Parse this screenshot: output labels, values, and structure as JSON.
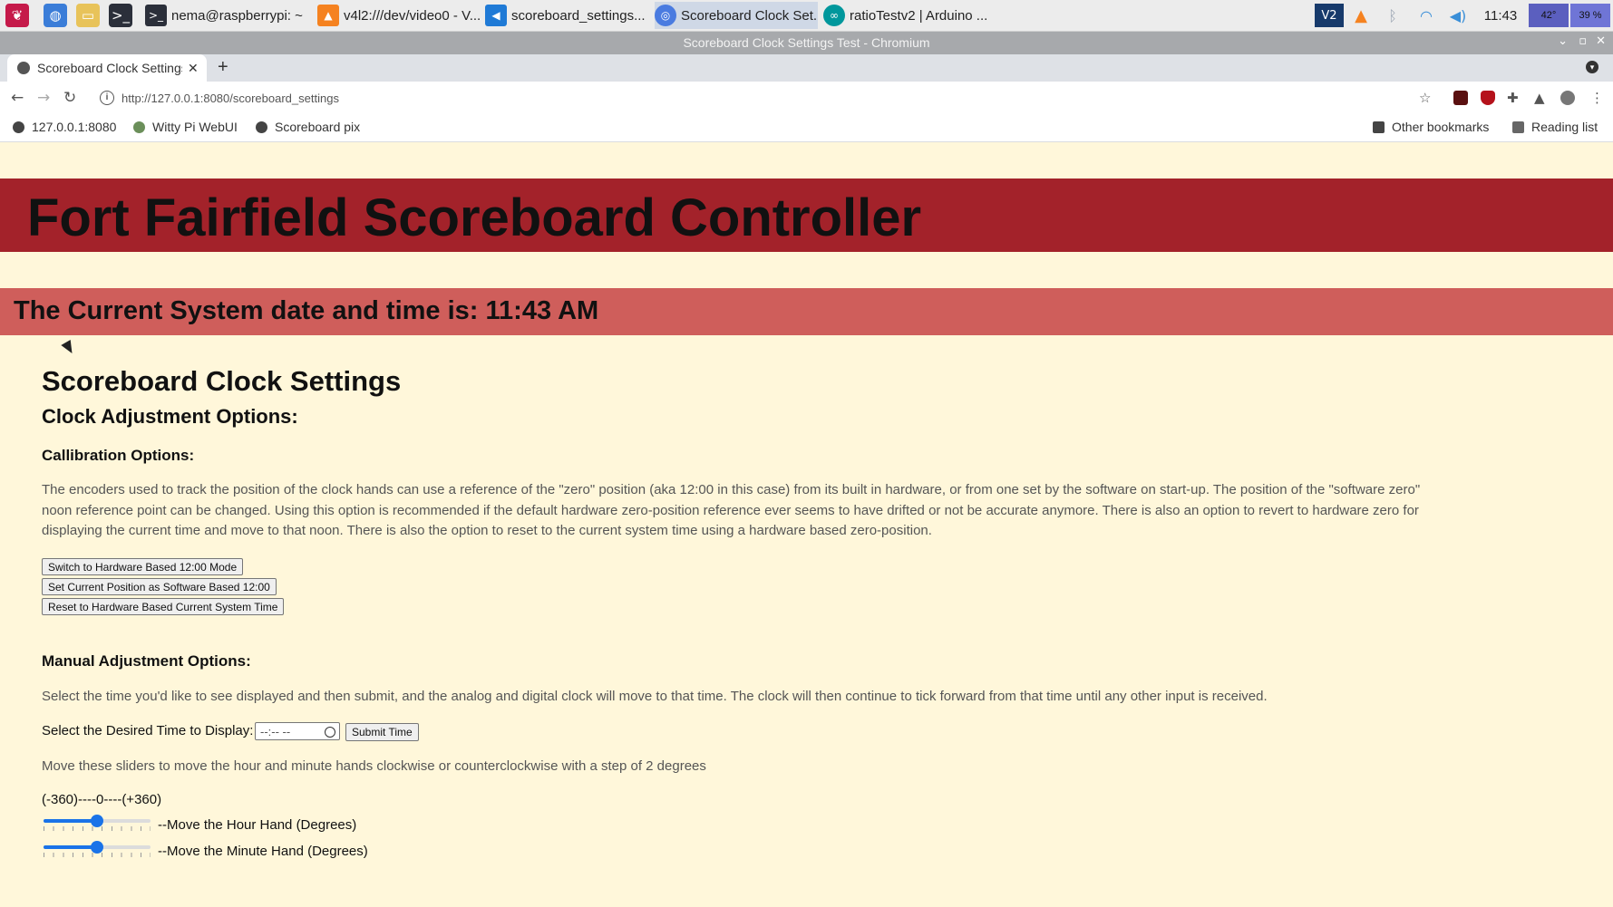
{
  "taskbar": {
    "tasks": [
      {
        "label": "nema@raspberrypi: ~"
      },
      {
        "label": "v4l2:///dev/video0 - V..."
      },
      {
        "label": "scoreboard_settings..."
      },
      {
        "label": "Scoreboard Clock Set..."
      },
      {
        "label": "ratioTestv2 | Arduino ..."
      }
    ],
    "tray": {
      "time": "11:43",
      "cpu_temp": "42°",
      "cpu_usage": "39 %"
    }
  },
  "window": {
    "title": "Scoreboard Clock Settings Test - Chromium"
  },
  "browser": {
    "tab_title": "Scoreboard Clock Settings",
    "url": "http://127.0.0.1:8080/scoreboard_settings",
    "bookmarks": [
      "127.0.0.1:8080",
      "Witty Pi WebUI",
      "Scoreboard pix"
    ],
    "other_bookmarks": "Other bookmarks",
    "reading_list": "Reading list"
  },
  "page": {
    "header_title": "Fort Fairfield Scoreboard Controller",
    "system_time_line": "The Current System date and time is: 11:43 AM",
    "section_title": "Scoreboard Clock Settings",
    "adjust_title": "Clock Adjustment Options:",
    "calibration": {
      "heading": "Callibration Options:",
      "description": "The encoders used to track the position of the clock hands can use a reference of the \"zero\" position (aka 12:00 in this case) from its built in hardware, or from one set by the software on start-up. The position of the \"software zero\" noon reference point can be changed. Using this option is recommended if the default hardware zero-position reference ever seems to have drifted or not be accurate anymore. There is also an option to revert to hardware zero for displaying the current time and move to that noon. There is also the option to reset to the current system time using a hardware based zero-position.",
      "buttons": [
        "Switch to Hardware Based 12:00 Mode",
        "Set Current Position as Software Based 12:00",
        "Reset to Hardware Based Current System Time"
      ]
    },
    "manual": {
      "heading": "Manual Adjustment Options:",
      "description": "Select the time you'd like to see displayed and then submit, and the analog and digital clock will move to that time. The clock will then continue to tick forward from that time until any other input is received.",
      "time_label": "Select the Desired Time to Display:",
      "time_placeholder": "--:-- --",
      "submit_label": "Submit Time",
      "slider_description": "Move these sliders to move the hour and minute hands clockwise or counterclockwise with a step of 2 degrees",
      "range_label": "(-360)----0----(+360)",
      "hour_slider": {
        "label": "--Move the Hour Hand (Degrees)",
        "value": 0
      },
      "minute_slider": {
        "label": "--Move the Minute Hand (Degrees)",
        "value": 0
      }
    }
  }
}
